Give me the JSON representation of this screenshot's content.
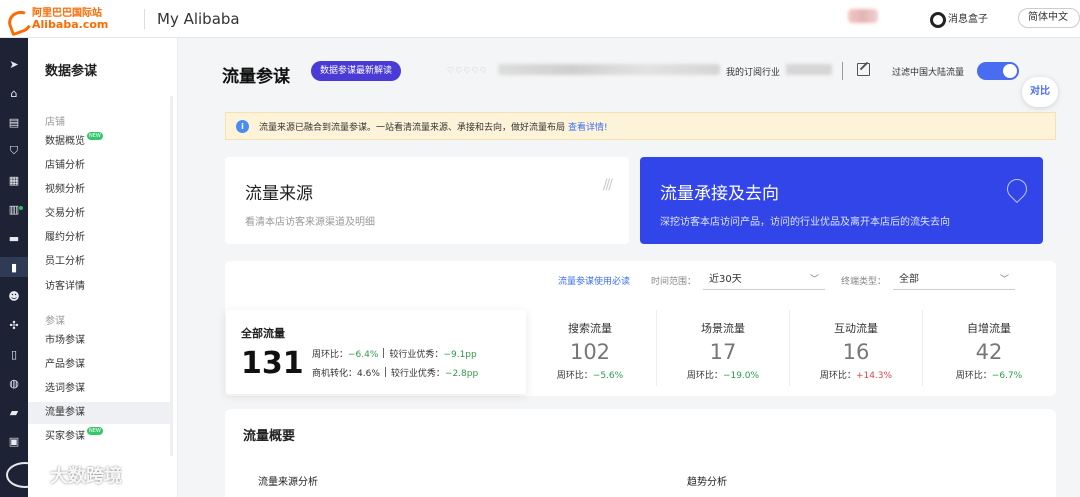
{
  "topbar": {
    "logo_cn": "阿里巴巴国际站",
    "logo_en": "Alibaba.com",
    "app_title": "My Alibaba",
    "msgbox_label": "消息盒子",
    "language": "简体中文"
  },
  "menu": {
    "title": "数据参谋",
    "groups": [
      {
        "label": "店铺",
        "items": [
          "数据概览",
          "店铺分析",
          "视频分析",
          "交易分析",
          "履约分析",
          "员工分析",
          "访客详情"
        ]
      },
      {
        "label": "参谋",
        "items": [
          "市场参谋",
          "产品参谋",
          "选词参谋",
          "流量参谋",
          "买家参谋"
        ]
      }
    ],
    "new_badge": "NEW",
    "active": "流量参谋"
  },
  "header": {
    "title": "流量参谋",
    "pill": "数据参谋最新解读",
    "stars": "♡♡♡♡♡",
    "industry_label": "我的订阅行业",
    "filter_label": "过滤中国大陆流量",
    "compare": "对比"
  },
  "notice": {
    "text": "流量来源已融合到流量参谋。一站看清流量来源、承接和去向，做好流量布局",
    "link": "查看详情!"
  },
  "cards": {
    "source": {
      "title": "流量来源",
      "subtitle": "看清本店访客来源渠道及明细"
    },
    "dest": {
      "title": "流量承接及去向",
      "subtitle": "深挖访客本店访问产品，访问的行业优品及离开本店后的流失去向"
    }
  },
  "filters": {
    "help": "流量参谋使用必读",
    "time_label": "时间范围：",
    "time_value": "近30天",
    "device_label": "终端类型：",
    "device_value": "全部"
  },
  "total": {
    "title": "全部流量",
    "value": "131",
    "wow_label": "周环比：",
    "wow": "−6.4%",
    "industry_label": "较行业优秀：",
    "industry_wow": "−9.1pp",
    "conv_label": "商机转化：",
    "conv": "4.6%",
    "conv_industry": "−2.8pp"
  },
  "substats": [
    {
      "name": "搜索流量",
      "value": "102",
      "change_label": "周环比：",
      "change": "−5.6%",
      "dir": "down"
    },
    {
      "name": "场景流量",
      "value": "17",
      "change_label": "周环比：",
      "change": "−19.0%",
      "dir": "down"
    },
    {
      "name": "互动流量",
      "value": "16",
      "change_label": "周环比：",
      "change": "+14.3%",
      "dir": "up"
    },
    {
      "name": "自增流量",
      "value": "42",
      "change_label": "周环比：",
      "change": "−6.7%",
      "dir": "down"
    }
  ],
  "overview": {
    "title": "流量概要",
    "left": "流量来源分析",
    "right": "趋势分析"
  },
  "watermark": "大数跨境",
  "rail_icons": [
    "send-icon",
    "home-icon",
    "calendar-icon",
    "shield-icon",
    "grid-icon",
    "store-icon",
    "chat-icon",
    "chart-icon",
    "users-icon",
    "network-icon",
    "document-icon",
    "globe-icon",
    "truck-icon",
    "bank-icon"
  ]
}
